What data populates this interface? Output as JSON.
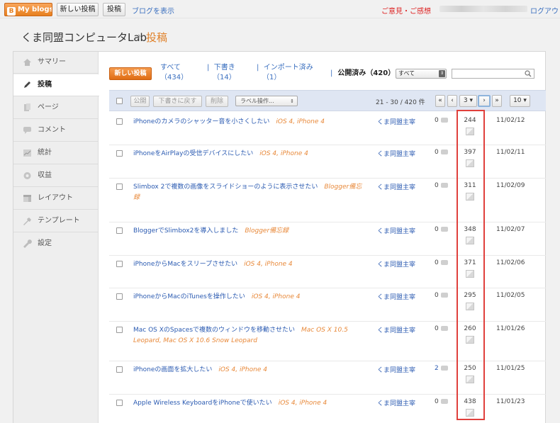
{
  "topbar": {
    "myblogs": "My blogs",
    "new_post": "新しい投稿",
    "posts": "投稿",
    "view_blog": "ブログを表示",
    "feedback": "ご意見・ご感想",
    "logout": "ログアウト"
  },
  "header": {
    "blog_title": "くま同盟コンピュータLab",
    "separator": "›",
    "page_title": "投稿"
  },
  "sidebar": {
    "items": [
      {
        "label": "サマリー",
        "icon": "home-icon"
      },
      {
        "label": "投稿",
        "icon": "pencil-icon",
        "active": true
      },
      {
        "label": "ページ",
        "icon": "page-icon"
      },
      {
        "label": "コメント",
        "icon": "comment-icon"
      },
      {
        "label": "統計",
        "icon": "stats-icon"
      },
      {
        "label": "収益",
        "icon": "earnings-icon"
      },
      {
        "label": "レイアウト",
        "icon": "layout-icon"
      },
      {
        "label": "テンプレート",
        "icon": "template-icon"
      },
      {
        "label": "設定",
        "icon": "wrench-icon"
      }
    ]
  },
  "filters": {
    "new_post_button": "新しい投稿",
    "all": "すべて",
    "all_count": "（434）",
    "drafts": "下書き",
    "drafts_count": "（14）",
    "imported": "インポート済み",
    "imported_count": "（1）",
    "published": "公開済み（420）",
    "select_value": "すべて"
  },
  "toolbar": {
    "publish": "公開",
    "revert_draft": "下書きに戻す",
    "delete": "削除",
    "label_actions": "ラベル操作...",
    "range": "21 - 30 / 420 件",
    "first": "«",
    "prev": "‹",
    "page": "3",
    "next": "›",
    "last": "»",
    "per_page": "10"
  },
  "posts": [
    {
      "title": "iPhoneのカメラのシャッター音を小さくしたい",
      "labels": "iOS 4, iPhone 4",
      "author": "くま同盟主宰",
      "comments": "0",
      "views": "244",
      "date": "11/02/12"
    },
    {
      "title": "iPhoneをAirPlayの受信デバイスにしたい",
      "labels": "iOS 4, iPhone 4",
      "author": "くま同盟主宰",
      "comments": "0",
      "views": "397",
      "date": "11/02/11"
    },
    {
      "title": "Slimbox 2で複数の画像をスライドショーのように表示させたい",
      "labels": "Blogger備忘録",
      "author": "くま同盟主宰",
      "comments": "0",
      "views": "311",
      "date": "11/02/09"
    },
    {
      "title": "BloggerでSlimbox2を導入しました",
      "labels": "Blogger備忘録",
      "author": "くま同盟主宰",
      "comments": "0",
      "views": "348",
      "date": "11/02/07"
    },
    {
      "title": "iPhoneからMacをスリープさせたい",
      "labels": "iOS 4, iPhone 4",
      "author": "くま同盟主宰",
      "comments": "0",
      "views": "371",
      "date": "11/02/06"
    },
    {
      "title": "iPhoneからMacのiTunesを操作したい",
      "labels": "iOS 4, iPhone 4",
      "author": "くま同盟主宰",
      "comments": "0",
      "views": "295",
      "date": "11/02/05"
    },
    {
      "title": "Mac OS XのSpacesで複数のウィンドウを移動させたい",
      "labels": "Mac OS X 10.5 Leopard, Mac OS X 10.6 Snow Leopard",
      "author": "くま同盟主宰",
      "comments": "0",
      "views": "260",
      "date": "11/01/26"
    },
    {
      "title": "iPhoneの画面を拡大したい",
      "labels": "iOS 4, iPhone 4",
      "author": "くま同盟主宰",
      "comments": "2",
      "views": "250",
      "date": "11/01/25"
    },
    {
      "title": "Apple Wireless KeyboardをiPhoneで使いたい",
      "labels": "iOS 4, iPhone 4",
      "author": "くま同盟主宰",
      "comments": "0",
      "views": "438",
      "date": "11/01/23"
    }
  ],
  "colors": {
    "accent": "#e0822b",
    "link": "#2a5ab1",
    "label": "#e8893a",
    "highlight": "#e0403c"
  }
}
